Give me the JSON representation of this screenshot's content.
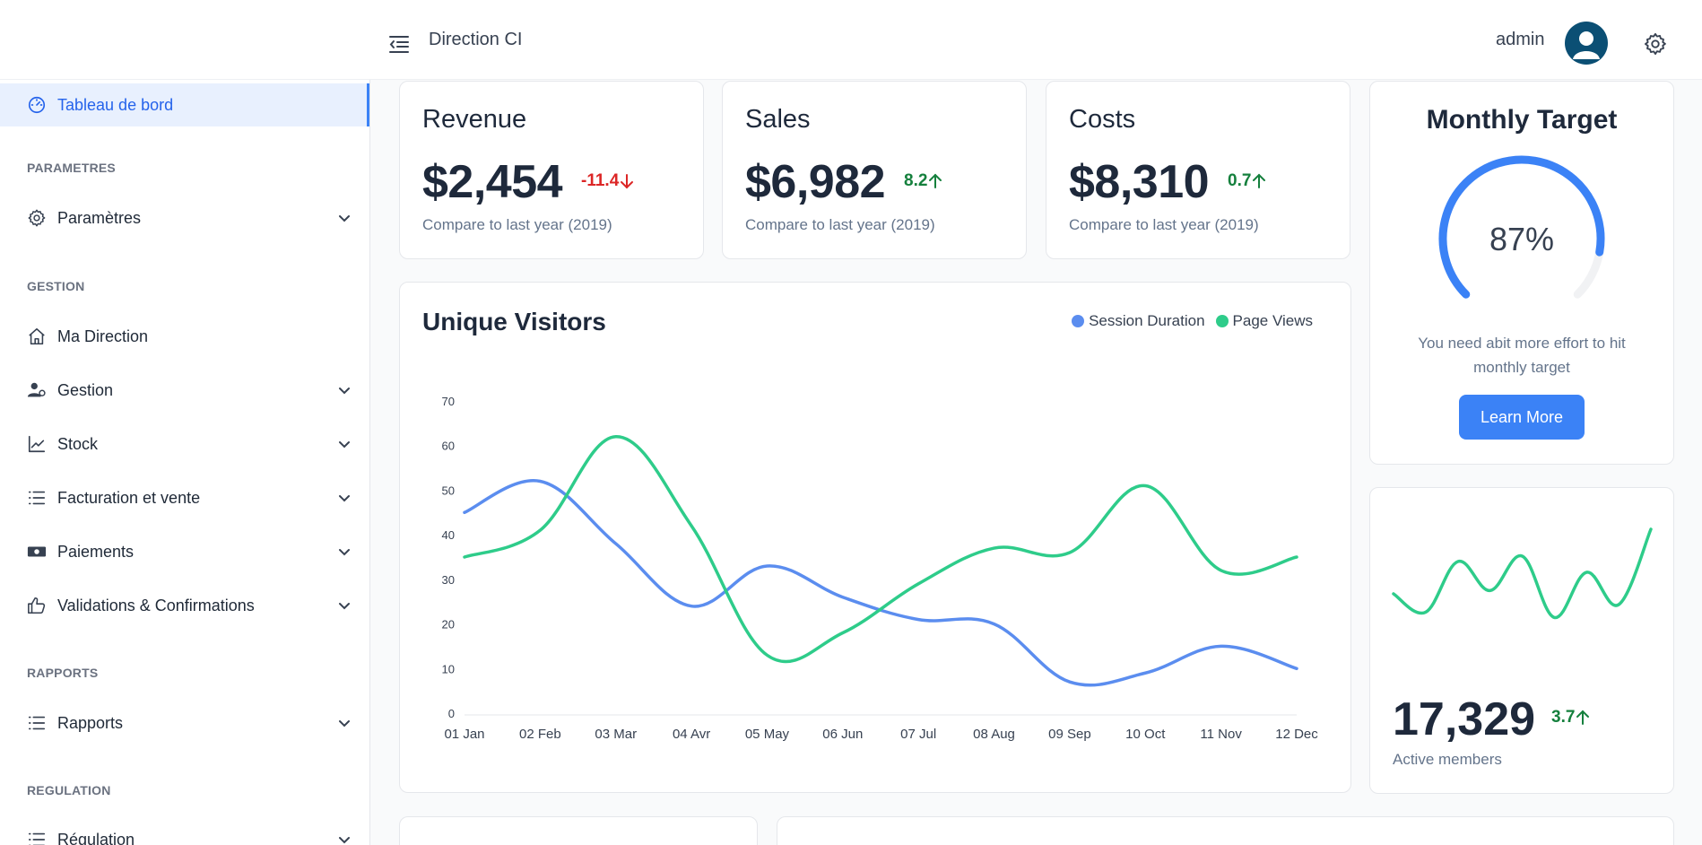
{
  "header": {
    "title": "Direction CI",
    "user_name": "admin"
  },
  "sidebar": {
    "active_item": "Tableau de bord",
    "sections": {
      "parametres": "PARAMETRES",
      "gestion": "GESTION",
      "rapports": "RAPPORTS",
      "regulation": "REGULATION"
    },
    "items": {
      "parametres": "Paramètres",
      "ma_direction": "Ma Direction",
      "gestion": "Gestion",
      "stock": "Stock",
      "facturation": "Facturation et vente",
      "paiements": "Paiements",
      "validations": "Validations & Confirmations",
      "rapports": "Rapports",
      "regulation": "Régulation"
    }
  },
  "kpis": {
    "revenue": {
      "title": "Revenue",
      "value": "$2,454",
      "delta": "-11.4",
      "subtitle": "Compare to last year (2019)"
    },
    "sales": {
      "title": "Sales",
      "value": "$6,982",
      "delta": "8.2",
      "subtitle": "Compare to last year (2019)"
    },
    "costs": {
      "title": "Costs",
      "value": "$8,310",
      "delta": "0.7",
      "subtitle": "Compare to last year (2019)"
    }
  },
  "visitors": {
    "title": "Unique Visitors",
    "legend_session": "Session Duration",
    "legend_pageviews": "Page Views"
  },
  "target": {
    "title": "Monthly Target",
    "percent_label": "87%",
    "percent": 87,
    "message": "You need abit more effort to hit monthly target",
    "button": "Learn More"
  },
  "members": {
    "value": "17,329",
    "delta": "3.7",
    "label": "Active members",
    "sparkline": [
      35,
      18,
      65,
      38,
      70,
      13,
      55,
      25,
      95
    ]
  },
  "colors": {
    "accent": "#3b82f6",
    "series_blue": "#5b8def",
    "series_green": "#2ecc8a",
    "down": "#dc2626",
    "up": "#15803d"
  },
  "chart_data": {
    "type": "line",
    "title": "Unique Visitors",
    "categories": [
      "01 Jan",
      "02 Feb",
      "03 Mar",
      "04 Avr",
      "05 May",
      "06 Jun",
      "07 Jul",
      "08 Aug",
      "09 Sep",
      "10 Oct",
      "11 Nov",
      "12 Dec"
    ],
    "series": [
      {
        "name": "Session Duration",
        "values": [
          45,
          52,
          38,
          24,
          33,
          26,
          21,
          20,
          7,
          9,
          15,
          10
        ]
      },
      {
        "name": "Page Views",
        "values": [
          35,
          41,
          62,
          42,
          13,
          18,
          29,
          37,
          36,
          51,
          32,
          35
        ]
      }
    ],
    "yticks": [
      0,
      10,
      20,
      30,
      40,
      50,
      60,
      70
    ],
    "ylim": [
      0,
      70
    ],
    "grid": false,
    "legend": "top-right"
  }
}
